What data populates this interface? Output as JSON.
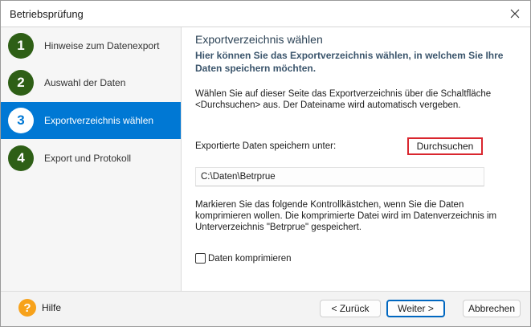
{
  "window": {
    "title": "Betriebsprüfung"
  },
  "steps": [
    {
      "number": "1",
      "label": "Hinweise zum Datenexport",
      "active": false
    },
    {
      "number": "2",
      "label": "Auswahl der Daten",
      "active": false
    },
    {
      "number": "3",
      "label": "Exportverzeichnis wählen",
      "active": true
    },
    {
      "number": "4",
      "label": "Export und Protokoll",
      "active": false
    }
  ],
  "content": {
    "heading": "Exportverzeichnis wählen",
    "subheading": "Hier können Sie das Exportverzeichnis wählen, in welchem Sie Ihre Daten speichern möchten.",
    "description": "Wählen Sie auf dieser Seite das Exportverzeichnis über die Schaltfläche <Durchsuchen> aus. Der Dateiname wird automatisch vergeben.",
    "export_label": "Exportierte Daten speichern unter:",
    "browse_button": "Durchsuchen",
    "path_value": "C:\\Daten\\Betrprue",
    "compress_description": "Markieren Sie das folgende Kontrollkästchen, wenn Sie die Daten komprimieren wollen. Die komprimierte Datei wird im Datenverzeichnis im Unterverzeichnis \"Betrprue\" gespeichert.",
    "compress_label": "Daten komprimieren",
    "compress_checked": false
  },
  "footer": {
    "help_icon": "?",
    "help_label": "Hilfe",
    "back_button": "< Zurück",
    "next_button": "Weiter >",
    "cancel_button": "Abbrechen"
  },
  "colors": {
    "accent": "#0078d4",
    "step_circle": "#2e5f16",
    "help_icon": "#f7a21b",
    "browse_highlight": "#d9262e"
  }
}
